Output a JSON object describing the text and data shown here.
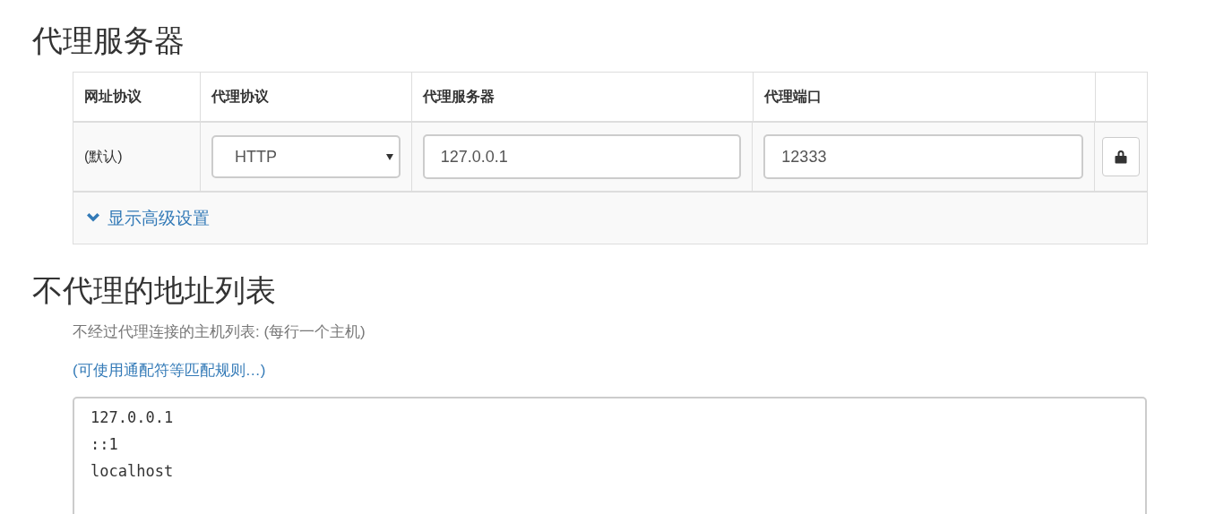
{
  "proxy_section": {
    "title": "代理服务器",
    "table": {
      "columns": [
        "网址协议",
        "代理协议",
        "代理服务器",
        "代理端口"
      ],
      "rows": [
        {
          "scheme": "(默认)",
          "protocol": "HTTP",
          "server": "127.0.0.1",
          "port": "12333"
        }
      ],
      "advanced_link": "显示高级设置"
    }
  },
  "bypass_section": {
    "title": "不代理的地址列表",
    "description": "不经过代理连接的主机列表: (每行一个主机)",
    "rules_link": "(可使用通配符等匹配规则…)",
    "hosts": [
      "127.0.0.1",
      "::1",
      "localhost"
    ]
  }
}
